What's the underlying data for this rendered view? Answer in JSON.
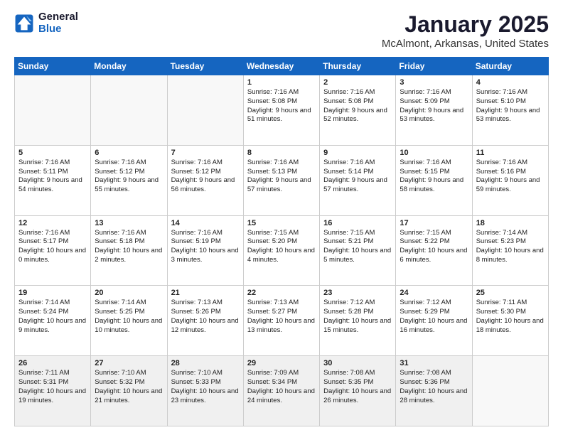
{
  "logo": {
    "line1": "General",
    "line2": "Blue"
  },
  "title": "January 2025",
  "subtitle": "McAlmont, Arkansas, United States",
  "weekdays": [
    "Sunday",
    "Monday",
    "Tuesday",
    "Wednesday",
    "Thursday",
    "Friday",
    "Saturday"
  ],
  "weeks": [
    [
      {
        "day": "",
        "info": ""
      },
      {
        "day": "",
        "info": ""
      },
      {
        "day": "",
        "info": ""
      },
      {
        "day": "1",
        "info": "Sunrise: 7:16 AM\nSunset: 5:08 PM\nDaylight: 9 hours\nand 51 minutes."
      },
      {
        "day": "2",
        "info": "Sunrise: 7:16 AM\nSunset: 5:08 PM\nDaylight: 9 hours\nand 52 minutes."
      },
      {
        "day": "3",
        "info": "Sunrise: 7:16 AM\nSunset: 5:09 PM\nDaylight: 9 hours\nand 53 minutes."
      },
      {
        "day": "4",
        "info": "Sunrise: 7:16 AM\nSunset: 5:10 PM\nDaylight: 9 hours\nand 53 minutes."
      }
    ],
    [
      {
        "day": "5",
        "info": "Sunrise: 7:16 AM\nSunset: 5:11 PM\nDaylight: 9 hours\nand 54 minutes."
      },
      {
        "day": "6",
        "info": "Sunrise: 7:16 AM\nSunset: 5:12 PM\nDaylight: 9 hours\nand 55 minutes."
      },
      {
        "day": "7",
        "info": "Sunrise: 7:16 AM\nSunset: 5:12 PM\nDaylight: 9 hours\nand 56 minutes."
      },
      {
        "day": "8",
        "info": "Sunrise: 7:16 AM\nSunset: 5:13 PM\nDaylight: 9 hours\nand 57 minutes."
      },
      {
        "day": "9",
        "info": "Sunrise: 7:16 AM\nSunset: 5:14 PM\nDaylight: 9 hours\nand 57 minutes."
      },
      {
        "day": "10",
        "info": "Sunrise: 7:16 AM\nSunset: 5:15 PM\nDaylight: 9 hours\nand 58 minutes."
      },
      {
        "day": "11",
        "info": "Sunrise: 7:16 AM\nSunset: 5:16 PM\nDaylight: 9 hours\nand 59 minutes."
      }
    ],
    [
      {
        "day": "12",
        "info": "Sunrise: 7:16 AM\nSunset: 5:17 PM\nDaylight: 10 hours\nand 0 minutes."
      },
      {
        "day": "13",
        "info": "Sunrise: 7:16 AM\nSunset: 5:18 PM\nDaylight: 10 hours\nand 2 minutes."
      },
      {
        "day": "14",
        "info": "Sunrise: 7:16 AM\nSunset: 5:19 PM\nDaylight: 10 hours\nand 3 minutes."
      },
      {
        "day": "15",
        "info": "Sunrise: 7:15 AM\nSunset: 5:20 PM\nDaylight: 10 hours\nand 4 minutes."
      },
      {
        "day": "16",
        "info": "Sunrise: 7:15 AM\nSunset: 5:21 PM\nDaylight: 10 hours\nand 5 minutes."
      },
      {
        "day": "17",
        "info": "Sunrise: 7:15 AM\nSunset: 5:22 PM\nDaylight: 10 hours\nand 6 minutes."
      },
      {
        "day": "18",
        "info": "Sunrise: 7:14 AM\nSunset: 5:23 PM\nDaylight: 10 hours\nand 8 minutes."
      }
    ],
    [
      {
        "day": "19",
        "info": "Sunrise: 7:14 AM\nSunset: 5:24 PM\nDaylight: 10 hours\nand 9 minutes."
      },
      {
        "day": "20",
        "info": "Sunrise: 7:14 AM\nSunset: 5:25 PM\nDaylight: 10 hours\nand 10 minutes."
      },
      {
        "day": "21",
        "info": "Sunrise: 7:13 AM\nSunset: 5:26 PM\nDaylight: 10 hours\nand 12 minutes."
      },
      {
        "day": "22",
        "info": "Sunrise: 7:13 AM\nSunset: 5:27 PM\nDaylight: 10 hours\nand 13 minutes."
      },
      {
        "day": "23",
        "info": "Sunrise: 7:12 AM\nSunset: 5:28 PM\nDaylight: 10 hours\nand 15 minutes."
      },
      {
        "day": "24",
        "info": "Sunrise: 7:12 AM\nSunset: 5:29 PM\nDaylight: 10 hours\nand 16 minutes."
      },
      {
        "day": "25",
        "info": "Sunrise: 7:11 AM\nSunset: 5:30 PM\nDaylight: 10 hours\nand 18 minutes."
      }
    ],
    [
      {
        "day": "26",
        "info": "Sunrise: 7:11 AM\nSunset: 5:31 PM\nDaylight: 10 hours\nand 19 minutes."
      },
      {
        "day": "27",
        "info": "Sunrise: 7:10 AM\nSunset: 5:32 PM\nDaylight: 10 hours\nand 21 minutes."
      },
      {
        "day": "28",
        "info": "Sunrise: 7:10 AM\nSunset: 5:33 PM\nDaylight: 10 hours\nand 23 minutes."
      },
      {
        "day": "29",
        "info": "Sunrise: 7:09 AM\nSunset: 5:34 PM\nDaylight: 10 hours\nand 24 minutes."
      },
      {
        "day": "30",
        "info": "Sunrise: 7:08 AM\nSunset: 5:35 PM\nDaylight: 10 hours\nand 26 minutes."
      },
      {
        "day": "31",
        "info": "Sunrise: 7:08 AM\nSunset: 5:36 PM\nDaylight: 10 hours\nand 28 minutes."
      },
      {
        "day": "",
        "info": ""
      }
    ]
  ]
}
